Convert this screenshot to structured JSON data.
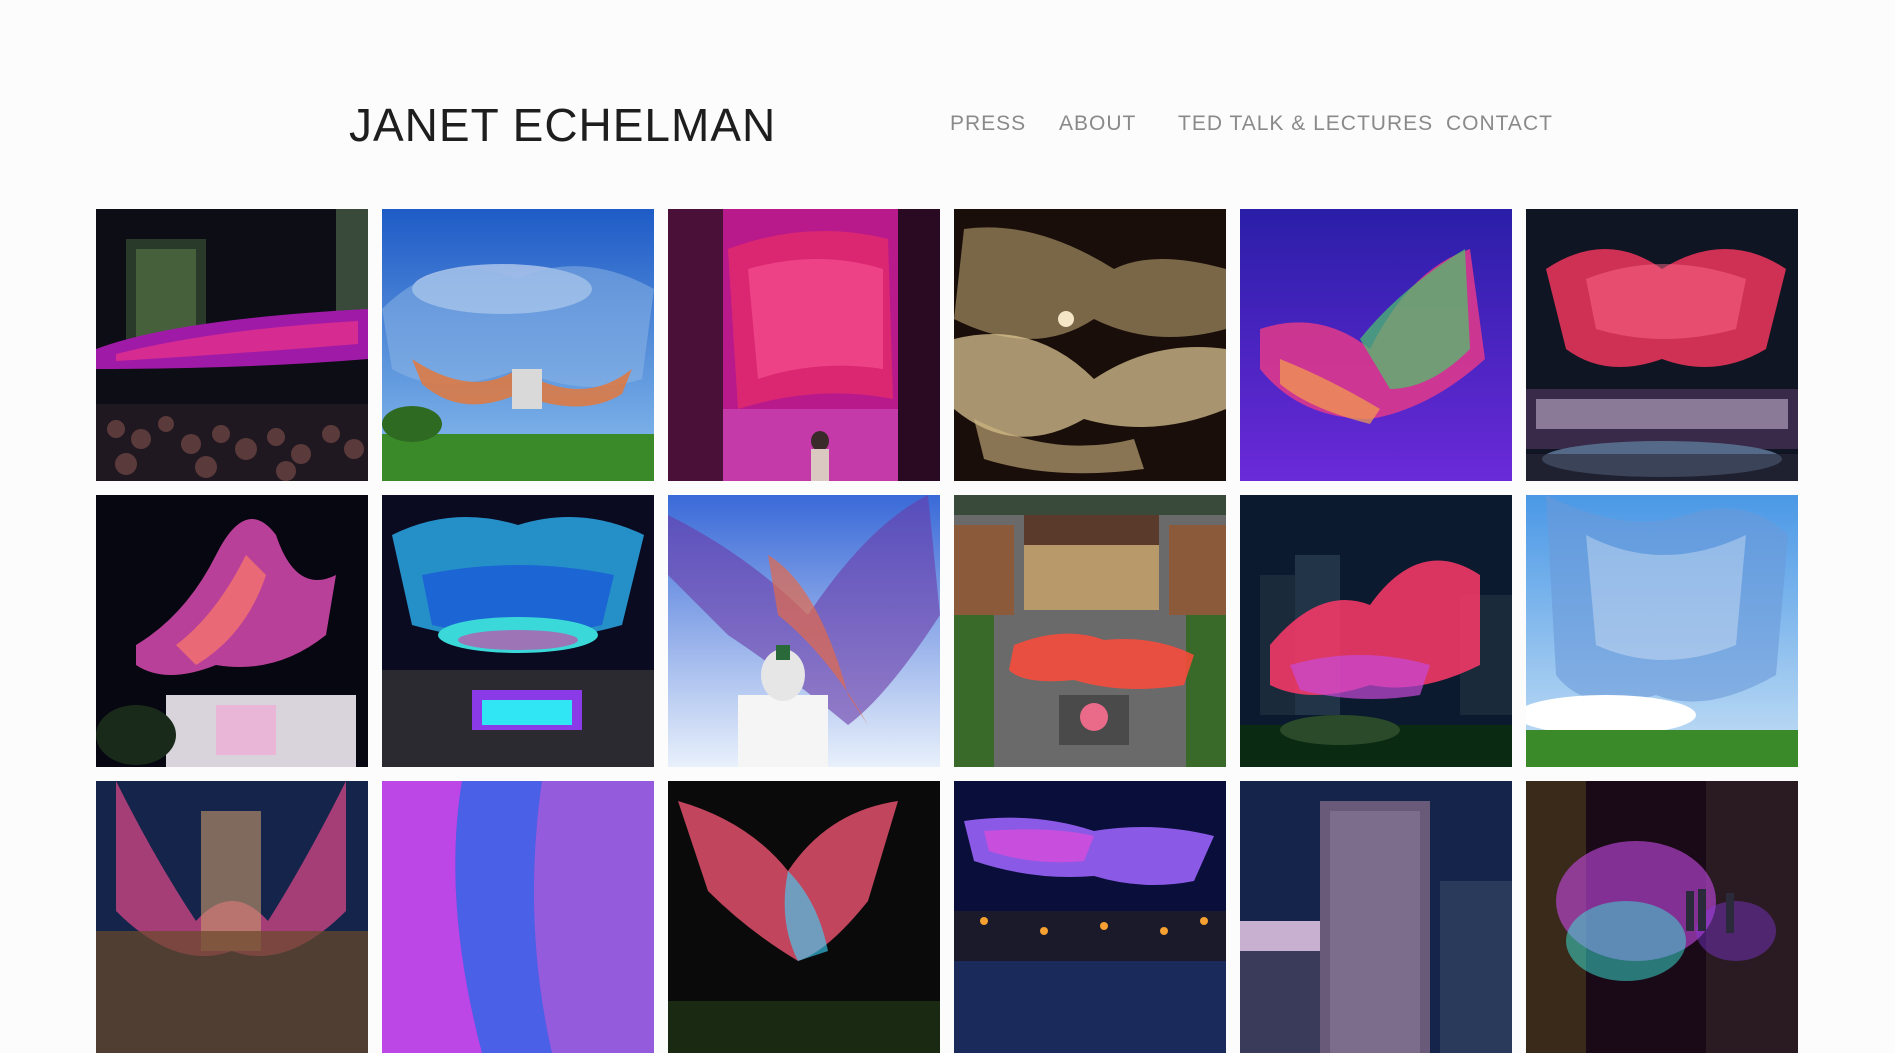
{
  "header": {
    "site_title": "JANET ECHELMAN",
    "nav": {
      "press": "PRESS",
      "about": "ABOUT",
      "ted": "TED TALK & LECTURES",
      "contact": "CONTACT"
    }
  },
  "gallery": {
    "tiles": [
      {
        "name": "gallery-tile-1",
        "image": "night-plaza-crowd-magenta-net"
      },
      {
        "name": "gallery-tile-2",
        "image": "daytime-blue-sky-net-over-park"
      },
      {
        "name": "gallery-tile-3",
        "image": "magenta-interior-net"
      },
      {
        "name": "gallery-tile-4",
        "image": "golden-net-indoor"
      },
      {
        "name": "gallery-tile-5",
        "image": "colorful-net-purple-sky"
      },
      {
        "name": "gallery-tile-6",
        "image": "red-net-over-fountain-plaza"
      },
      {
        "name": "gallery-tile-7",
        "image": "pink-net-over-historic-building"
      },
      {
        "name": "gallery-tile-8",
        "image": "blue-net-over-illuminated-pool"
      },
      {
        "name": "gallery-tile-9",
        "image": "net-over-white-cathedral"
      },
      {
        "name": "gallery-tile-10",
        "image": "aerial-square-with-net"
      },
      {
        "name": "gallery-tile-11",
        "image": "red-net-city-night"
      },
      {
        "name": "gallery-tile-12",
        "image": "blue-net-over-field"
      },
      {
        "name": "gallery-tile-13",
        "image": "pink-net-towers"
      },
      {
        "name": "gallery-tile-14",
        "image": "purple-blue-net-closeup"
      },
      {
        "name": "gallery-tile-15",
        "image": "orange-net-night-trees"
      },
      {
        "name": "gallery-tile-16",
        "image": "blue-net-over-lake-night"
      },
      {
        "name": "gallery-tile-17",
        "image": "tower-at-dusk"
      },
      {
        "name": "gallery-tile-18",
        "image": "mist-lights-night-street"
      }
    ]
  }
}
